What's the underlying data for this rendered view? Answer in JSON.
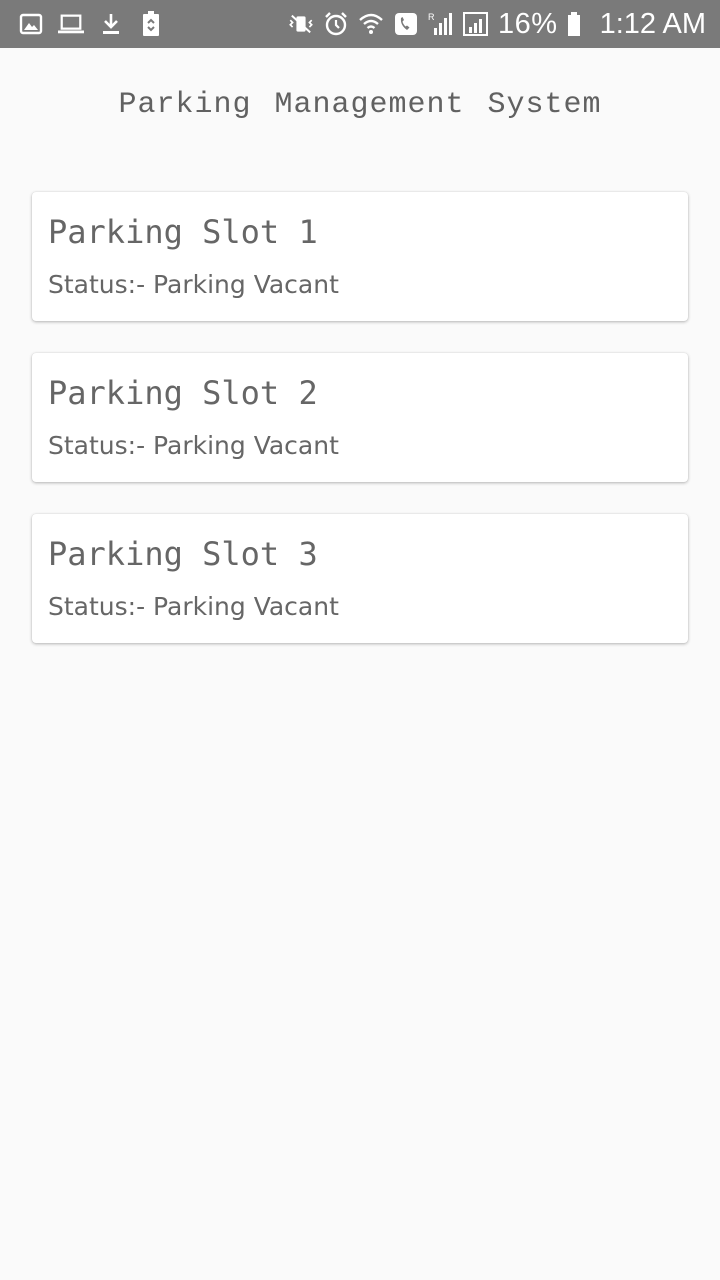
{
  "status_bar": {
    "left_icons": [
      "image-icon",
      "laptop-icon",
      "download-icon",
      "battery-saver-icon"
    ],
    "right_icons": [
      "vibrate-mute-icon",
      "alarm-icon",
      "wifi-icon",
      "phone-call-icon",
      "signal-roaming-icon",
      "signal-icon"
    ],
    "battery_percent": "16%",
    "time": "1:12 AM",
    "bar_color": "#7a7a7a"
  },
  "header": {
    "title": "Parking Management System"
  },
  "slots": [
    {
      "name": "Parking Slot 1",
      "status": "Status:- Parking Vacant"
    },
    {
      "name": "Parking Slot 2",
      "status": "Status:- Parking Vacant"
    },
    {
      "name": "Parking Slot 3",
      "status": "Status:- Parking Vacant"
    }
  ]
}
